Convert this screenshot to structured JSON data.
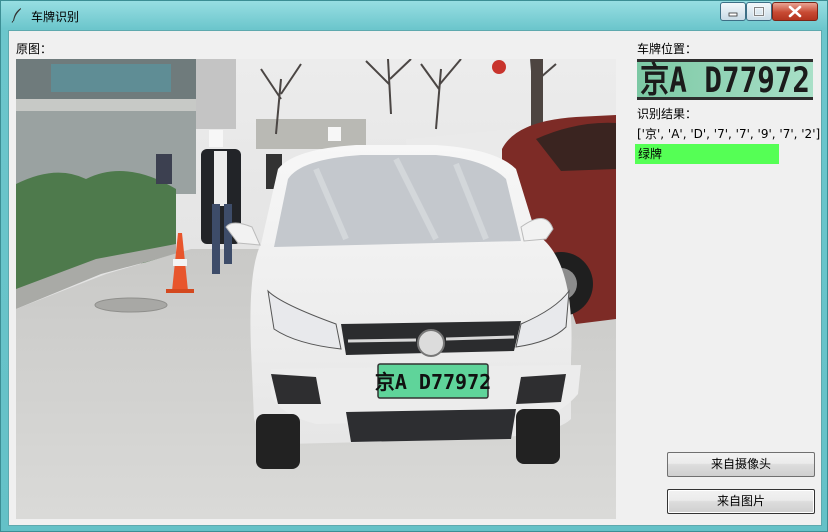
{
  "window": {
    "title": "车牌识别",
    "controls": {
      "minimize_icon": "minimize-icon",
      "maximize_icon": "maximize-icon",
      "close_icon": "close-icon"
    }
  },
  "labels": {
    "original": "原图：",
    "plate_position": "车牌位置：",
    "recognition_result": "识别结果："
  },
  "result": {
    "characters_text": "['京', 'A', 'D', '7', '7', '9', '7', '2']",
    "plate_color": "绿牌",
    "plate_color_hex": "#55ff55"
  },
  "plate": {
    "text": "京A D77972",
    "plate_bg": "#5fd49a"
  },
  "buttons": {
    "camera": "来自摄像头",
    "picture": "来自图片"
  }
}
